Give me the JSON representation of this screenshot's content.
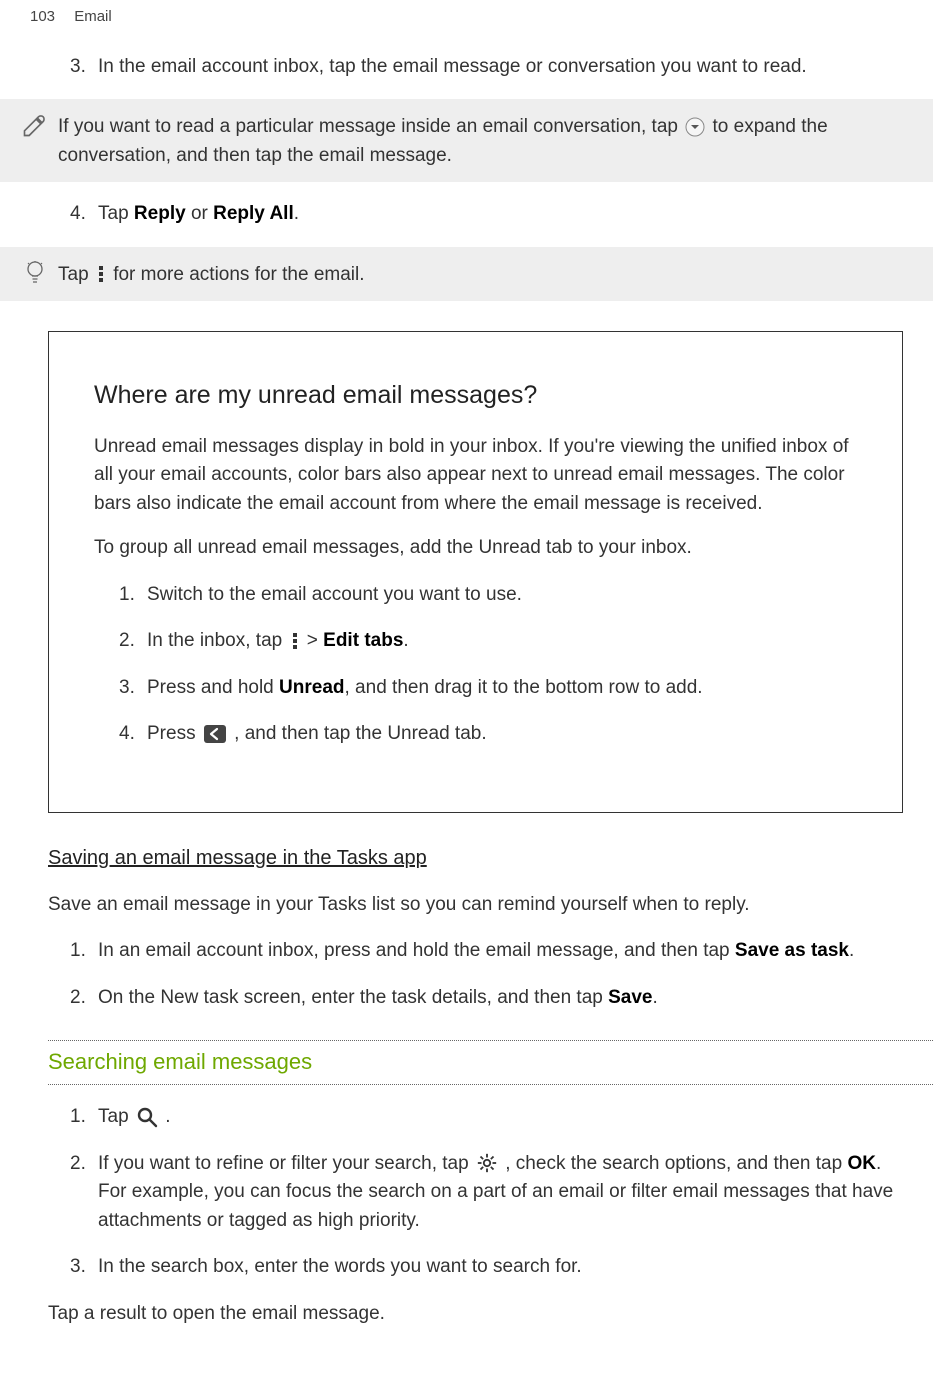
{
  "header": {
    "pagenum": "103",
    "section": "Email"
  },
  "top_steps": {
    "step3_num": "3.",
    "step3_text": "In the email account inbox, tap the email message or conversation you want to read.",
    "step4_num": "4.",
    "step4_pre": "Tap ",
    "step4_reply": "Reply",
    "step4_or": " or ",
    "step4_replyall": "Reply All",
    "step4_end": "."
  },
  "note_expand": {
    "pre": "If you want to read a particular message inside an email conversation, tap ",
    "post": " to expand the conversation, and then tap the email message."
  },
  "tip_more": {
    "pre": "Tap ",
    "post": " for more actions for the email."
  },
  "unread_box": {
    "heading": "Where are my unread email messages?",
    "para1": "Unread email messages display in bold in your inbox. If you're viewing the unified inbox of all your email accounts, color bars also appear next to unread email messages. The color bars also indicate the email account from where the email message is received.",
    "para2": "To group all unread email messages, add the Unread tab to your inbox.",
    "s1_num": "1.",
    "s1_text": "Switch to the email account you want to use.",
    "s2_num": "2.",
    "s2_pre": "In the inbox, tap ",
    "s2_gt": " > ",
    "s2_edit": "Edit tabs",
    "s2_end": ".",
    "s3_num": "3.",
    "s3_pre": "Press and hold ",
    "s3_unread": "Unread",
    "s3_post": ", and then drag it to the bottom row to add.",
    "s4_num": "4.",
    "s4_pre": "Press ",
    "s4_post": ", and then tap the Unread tab."
  },
  "tasks_section": {
    "heading": "Saving an email message in the Tasks app",
    "intro": "Save an email message in your Tasks list so you can remind yourself when to reply.",
    "s1_num": "1.",
    "s1_pre": "In an email account inbox, press and hold the email message, and then tap ",
    "s1_save": "Save as task",
    "s1_end": ".",
    "s2_num": "2.",
    "s2_pre": "On the New task screen, enter the task details, and then tap ",
    "s2_save": "Save",
    "s2_end": "."
  },
  "search_section": {
    "heading": "Searching email messages",
    "s1_num": "1.",
    "s1_pre": "Tap ",
    "s1_end": ".",
    "s2_num": "2.",
    "s2_pre": "If you want to refine or filter your search, tap ",
    "s2_mid": ", check the search options, and then tap ",
    "s2_ok": "OK",
    "s2_post": ". For example, you can focus the search on a part of an email or filter email messages that have attachments or tagged as high priority.",
    "s3_num": "3.",
    "s3_text": "In the search box, enter the words you want to search for.",
    "tail": "Tap a result to open the email message."
  }
}
